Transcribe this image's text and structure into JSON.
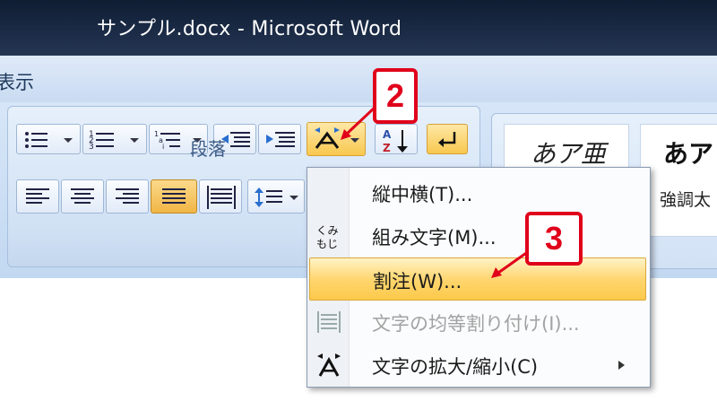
{
  "window": {
    "title": "サンプル.docx - Microsoft Word"
  },
  "ribbon": {
    "visible_tab": "表示",
    "paragraph_group_label": "段落",
    "styles": [
      {
        "sample": "あア亜",
        "label": ""
      },
      {
        "sample": "あア",
        "label": "強調太"
      }
    ]
  },
  "context_menu": {
    "items": [
      {
        "label": "縦中横(T)...",
        "icon": "tate-chu-yoko-icon",
        "state": "normal"
      },
      {
        "label": "組み文字(M)...",
        "icon": "kumi-moji-icon",
        "state": "normal"
      },
      {
        "label": "割注(W)...",
        "icon": "",
        "state": "highlighted"
      },
      {
        "label": "文字の均等割り付け(I)...",
        "icon": "distribute-text-icon",
        "state": "disabled"
      },
      {
        "label": "文字の拡大/縮小(C)",
        "icon": "scale-text-icon",
        "state": "normal",
        "submenu": true
      }
    ]
  },
  "callouts": {
    "step2": "2",
    "step3": "3"
  },
  "colors": {
    "callout": "#e0001a",
    "highlight": "#ffd670",
    "titlebar": "#1c2c47"
  }
}
